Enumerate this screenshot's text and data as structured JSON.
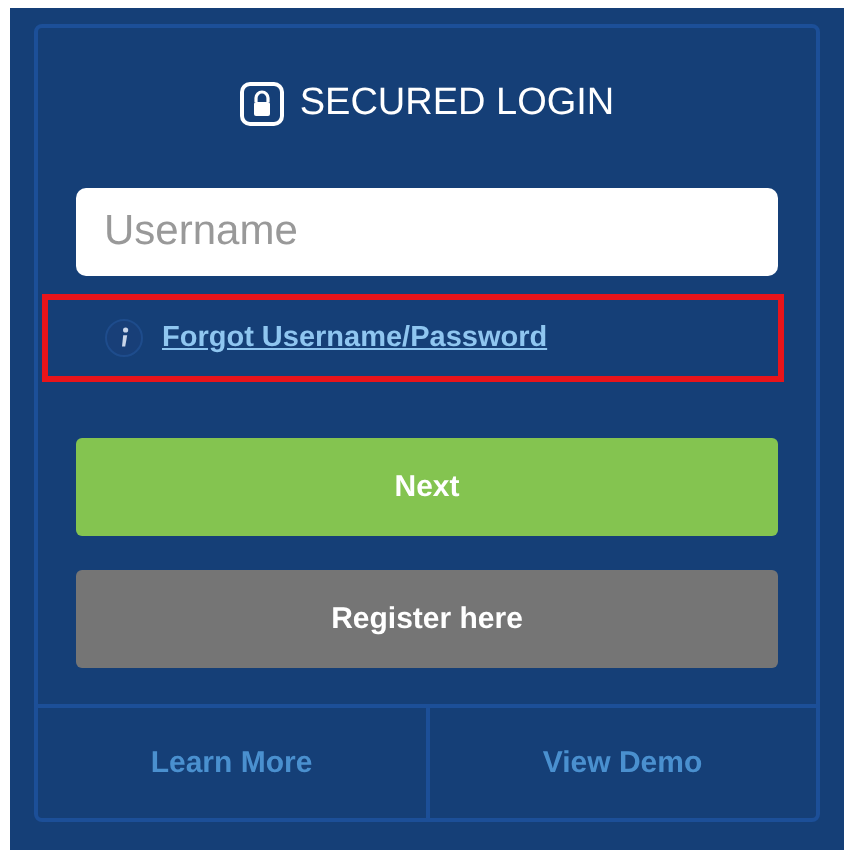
{
  "header": {
    "title": "SECURED LOGIN"
  },
  "username_field": {
    "placeholder": "Username"
  },
  "forgot_link": {
    "label": "Forgot Username/Password",
    "highlighted": true
  },
  "buttons": [
    {
      "label": "Next",
      "kind": "primary"
    },
    {
      "label": "Register here",
      "kind": "secondary"
    }
  ],
  "footer_links": [
    {
      "label": "Learn More"
    },
    {
      "label": "View Demo"
    }
  ]
}
